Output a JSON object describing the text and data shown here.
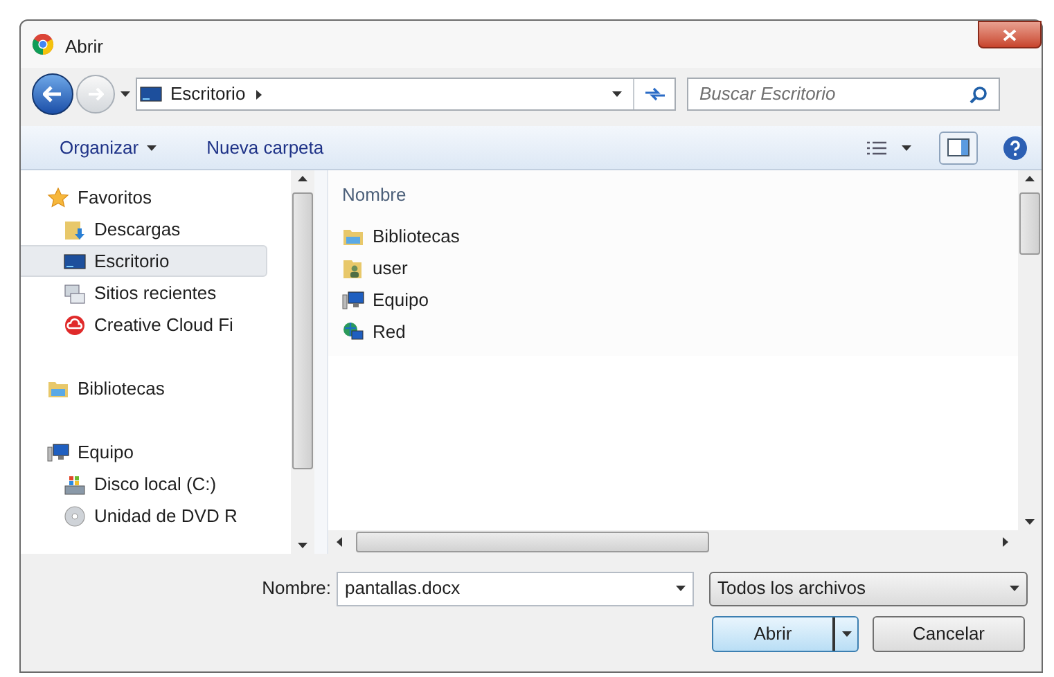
{
  "window": {
    "title": "Abrir"
  },
  "address": {
    "location": "Escritorio",
    "search_placeholder": "Buscar Escritorio"
  },
  "toolbar": {
    "organize": "Organizar",
    "new_folder": "Nueva carpeta"
  },
  "nav": [
    {
      "label": "Favoritos",
      "kind": "star",
      "selected": false,
      "children": [
        {
          "label": "Descargas",
          "kind": "downloads",
          "selected": false
        },
        {
          "label": "Escritorio",
          "kind": "desktop",
          "selected": true
        },
        {
          "label": "Sitios recientes",
          "kind": "recent",
          "selected": false
        },
        {
          "label": "Creative Cloud Fi",
          "kind": "cloud",
          "selected": false
        }
      ]
    },
    {
      "label": "Bibliotecas",
      "kind": "library",
      "selected": false
    },
    {
      "label": "Equipo",
      "kind": "computer",
      "selected": false,
      "children": [
        {
          "label": "Disco local (C:)",
          "kind": "disk",
          "selected": false
        },
        {
          "label": "Unidad de DVD R",
          "kind": "dvd",
          "selected": false
        }
      ]
    }
  ],
  "files": {
    "column": "Nombre",
    "items": [
      {
        "label": "Bibliotecas",
        "kind": "library"
      },
      {
        "label": "user",
        "kind": "user"
      },
      {
        "label": "Equipo",
        "kind": "computer"
      },
      {
        "label": "Red",
        "kind": "network"
      }
    ]
  },
  "footer": {
    "name_label": "Nombre:",
    "name_value": "pantallas.docx",
    "filter": "Todos los archivos",
    "open": "Abrir",
    "cancel": "Cancelar"
  }
}
